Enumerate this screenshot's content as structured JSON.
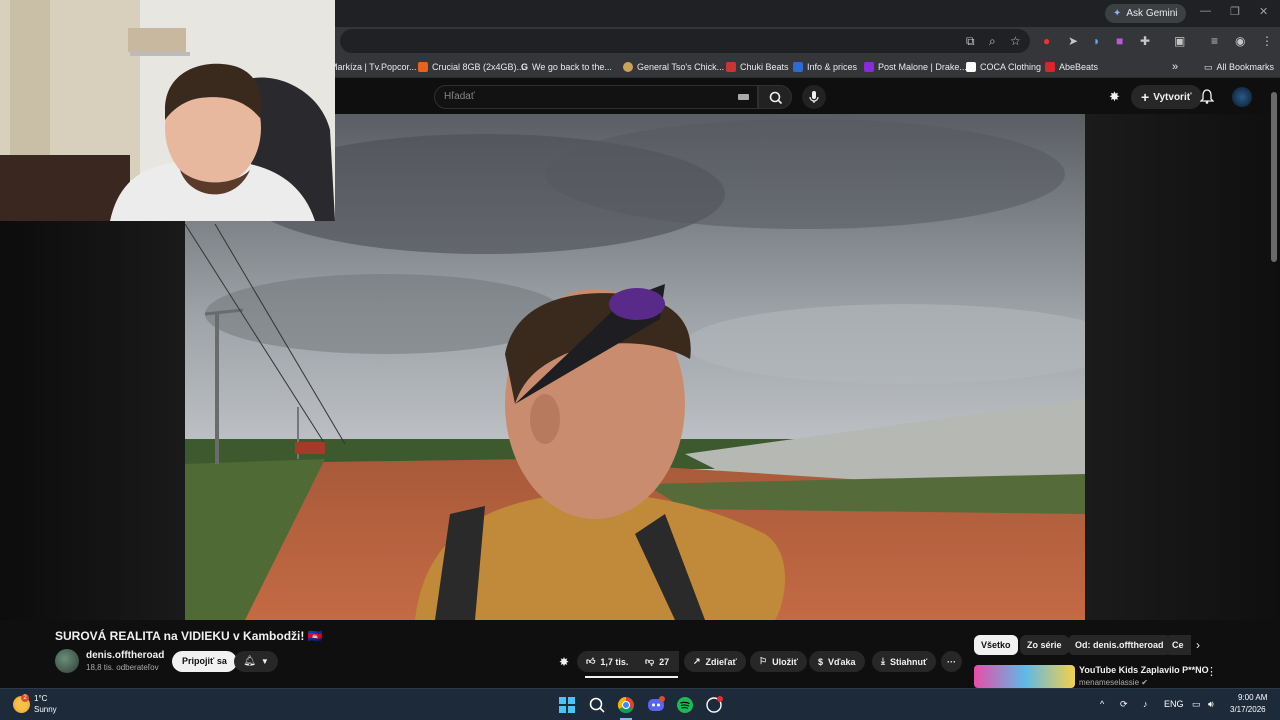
{
  "browser": {
    "gemini_label": "Ask Gemini",
    "bookmarks": [
      "Markíza | Tv.Popcor...",
      "Crucial 8GB (2x4GB)...",
      "We go back to the...",
      "General Tso's Chick...",
      "Chuki Beats",
      "Info & prices",
      "Post Malone | Drake...",
      "COCA Clothing",
      "AbeBeats"
    ],
    "bookmark_overflow": "»",
    "all_bookmarks": "All Bookmarks"
  },
  "youtube": {
    "search_placeholder": "Hľadať",
    "create_label": "Vytvoriť",
    "video": {
      "title": "SUROVÁ REALITA na VIDIEKU v Kambodži! 🇰🇭",
      "channel": "denis.offtheroad",
      "subscribers": "18,8 tis. odberateľov",
      "join_label": "Pripojiť sa",
      "likes": "1,7 tis.",
      "dislikes": "27",
      "share_label": "Zdieľať",
      "save_label": "Uložiť",
      "thanks_label": "Vďaka",
      "download_label": "Stiahnuť",
      "more_label": "···"
    },
    "chips": [
      "Všetko",
      "Zo série",
      "Od: denis.offtheroad",
      "Ce"
    ],
    "recommendation": {
      "title": "YouTube Kids Zaplavilo P**NO",
      "channel": "menameselassie ✔"
    }
  },
  "taskbar": {
    "temperature": "1°C",
    "condition": "Sunny",
    "weather_badge": "2",
    "language": "ENG",
    "time": "9:00 AM",
    "date": "3/17/2026"
  },
  "colors": {
    "youtube_bg": "#0f0f0f",
    "chrome_dark": "#202124",
    "taskbar": "#1c2a3a"
  }
}
